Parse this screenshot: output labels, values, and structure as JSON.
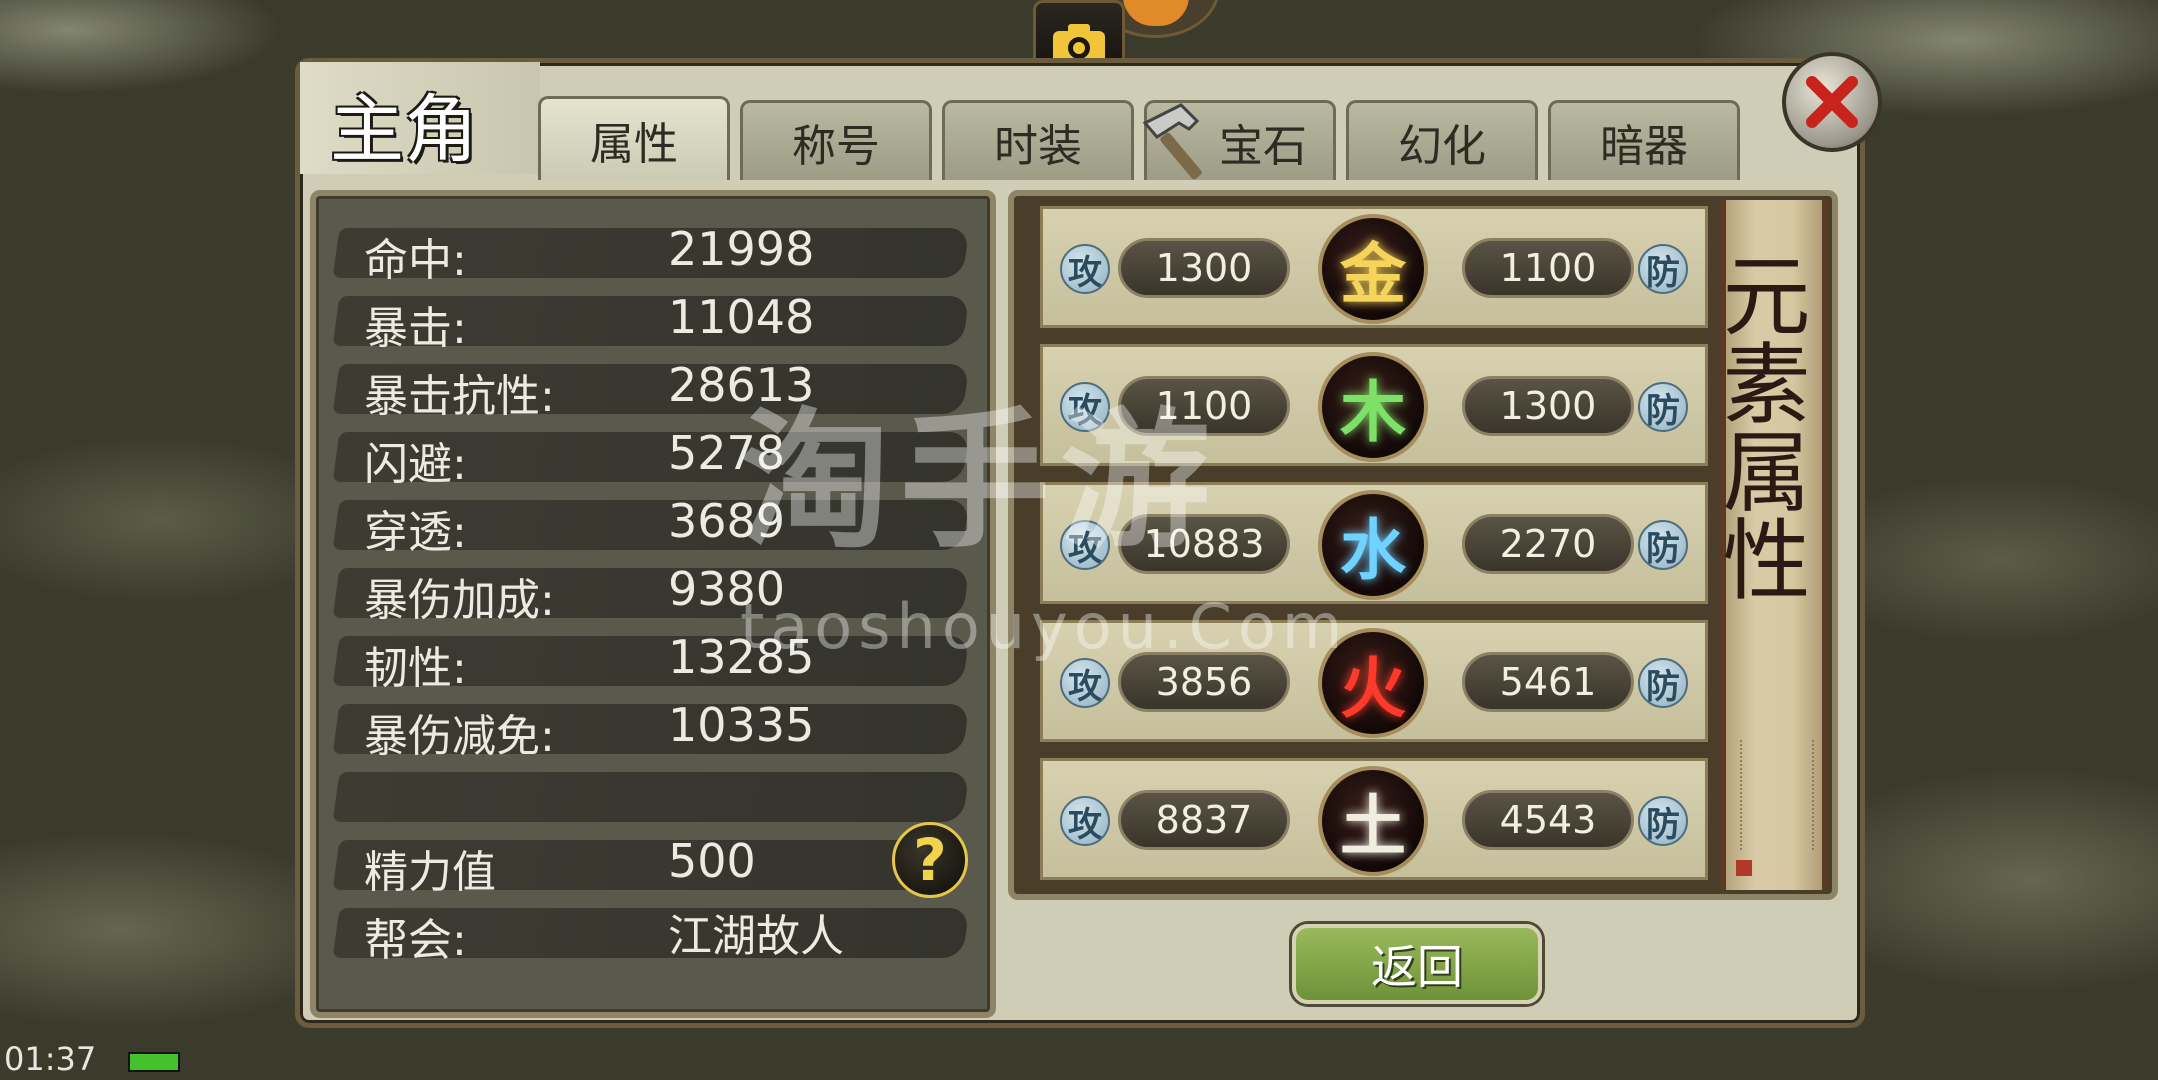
{
  "window": {
    "title": "主角"
  },
  "tabs": [
    {
      "label": "属性",
      "active": true
    },
    {
      "label": "称号",
      "active": false
    },
    {
      "label": "时装",
      "active": false
    },
    {
      "label": "宝石",
      "active": false,
      "icon": "hammer-icon"
    },
    {
      "label": "幻化",
      "active": false
    },
    {
      "label": "暗器",
      "active": false
    }
  ],
  "stats": [
    {
      "label": "命中:",
      "value": "21998"
    },
    {
      "label": "暴击:",
      "value": "11048"
    },
    {
      "label": "暴击抗性:",
      "value": "28613"
    },
    {
      "label": "闪避:",
      "value": "5278"
    },
    {
      "label": "穿透:",
      "value": "3689"
    },
    {
      "label": "暴伤加成:",
      "value": "9380"
    },
    {
      "label": "韧性:",
      "value": "13285"
    },
    {
      "label": "暴伤减免:",
      "value": "10335"
    },
    {
      "label": "",
      "value": ""
    },
    {
      "label": "精力值",
      "value": "500"
    },
    {
      "label": "帮会:",
      "value": "江湖故人"
    }
  ],
  "elements": {
    "attack_label": "攻",
    "defense_label": "防",
    "rows": [
      {
        "element": "金",
        "attack": "1300",
        "defense": "1100",
        "color": "#f4d45a"
      },
      {
        "element": "木",
        "attack": "1100",
        "defense": "1300",
        "color": "#7de067"
      },
      {
        "element": "水",
        "attack": "10883",
        "defense": "2270",
        "color": "#6fd2ff"
      },
      {
        "element": "火",
        "attack": "3856",
        "defense": "5461",
        "color": "#ff3a2a"
      },
      {
        "element": "土",
        "attack": "8837",
        "defense": "4543",
        "color": "#f1eee0"
      }
    ]
  },
  "scroll": {
    "title": "元素属性"
  },
  "buttons": {
    "back": "返回",
    "help": "?"
  },
  "watermark": {
    "main": "淘手游",
    "sub": "taoshouyou.Com"
  },
  "status_bar": {
    "time": "01:37",
    "battery_color": "#43c22b"
  },
  "icons": {
    "camera": "camera-icon",
    "close": "close-icon"
  }
}
